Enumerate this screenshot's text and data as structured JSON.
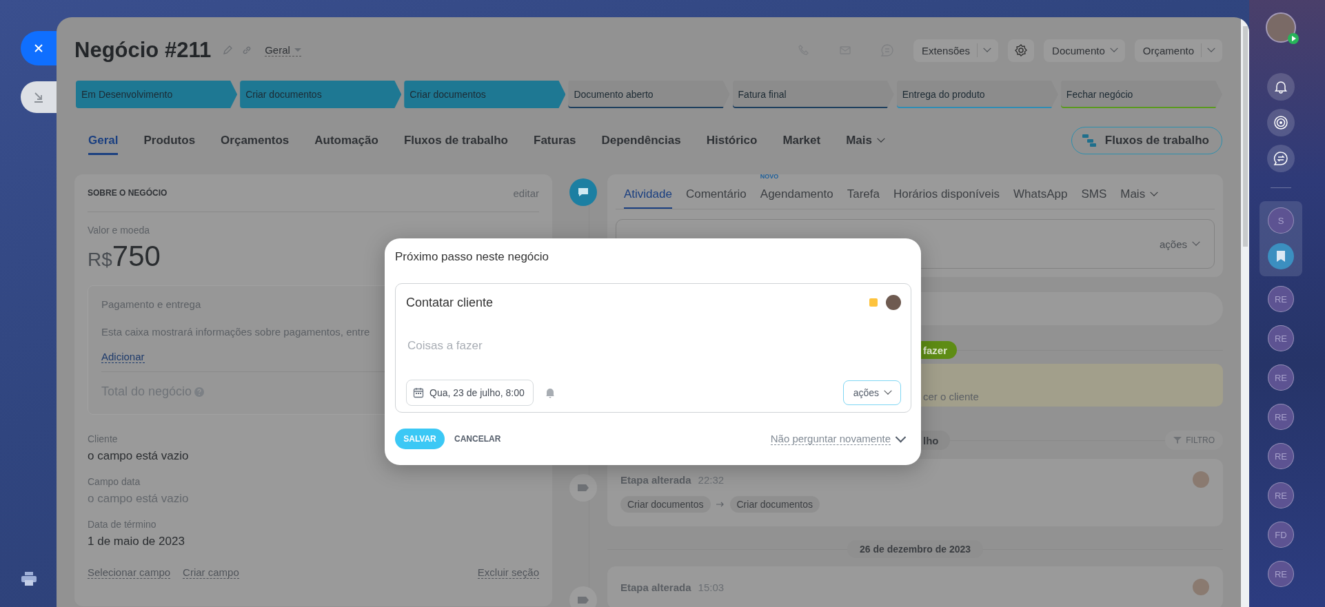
{
  "header": {
    "title": "Negócio #211",
    "category": "Geral",
    "buttons": [
      {
        "kind": "split",
        "label": "Extensões"
      },
      {
        "kind": "icon"
      },
      {
        "kind": "dropdown",
        "label": "Documento"
      },
      {
        "kind": "split",
        "label": "Orçamento"
      }
    ]
  },
  "stages": [
    {
      "label": "Em Desenvolvimento",
      "reached": true,
      "color": "#1e7893"
    },
    {
      "label": "Criar documentos",
      "reached": true,
      "color": "#1e7893"
    },
    {
      "label": "Criar documentos",
      "reached": true,
      "color": "#1e7893"
    },
    {
      "label": "Documento aberto",
      "reached": false,
      "color": "#1d3f5e"
    },
    {
      "label": "Fatura final",
      "reached": false,
      "color": "#1d3f5e"
    },
    {
      "label": "Entrega do produto",
      "reached": false,
      "color": "#2f8db5"
    },
    {
      "label": "Fechar negócio",
      "reached": false,
      "color": "#5a9a1e"
    }
  ],
  "tabs": [
    {
      "label": "Geral",
      "selected": true,
      "kind": "tab"
    },
    {
      "label": "Produtos",
      "selected": false,
      "kind": "tab"
    },
    {
      "label": "Orçamentos",
      "selected": false,
      "kind": "tab"
    },
    {
      "label": "Automação",
      "selected": false,
      "kind": "tab"
    },
    {
      "label": "Fluxos de trabalho",
      "selected": false,
      "kind": "tab"
    },
    {
      "label": "Faturas",
      "selected": false,
      "kind": "tab"
    },
    {
      "label": "Dependências",
      "selected": false,
      "kind": "tab"
    },
    {
      "label": "Histórico",
      "selected": false,
      "kind": "tab"
    },
    {
      "label": "Market",
      "selected": false,
      "kind": "tab"
    },
    {
      "label": "Mais",
      "selected": false,
      "kind": "menu"
    }
  ],
  "workflow_button": "Fluxos de trabalho",
  "about": {
    "title": "SOBRE O NEGÓCIO",
    "edit": "editar",
    "amount_label": "Valor e moeda",
    "currency": "R$",
    "amount": "750",
    "payment": {
      "title": "Pagamento e entrega",
      "description": "Esta caixa mostrará informações sobre pagamentos, entre",
      "link": "Adicionar",
      "total_label": "Total do negócio"
    },
    "fields": [
      {
        "label": "Cliente",
        "value": "o campo está vazio",
        "muted": false
      },
      {
        "label": "Campo data",
        "value": "o campo está vazio",
        "muted": true
      },
      {
        "label": "Data de término",
        "value": "1 de maio de 2023",
        "muted": false
      }
    ],
    "links": [
      "Selecionar campo",
      "Criar campo"
    ],
    "delete_link": "Excluir seção"
  },
  "activity": {
    "tabs": [
      {
        "label": "Atividade",
        "selected": true,
        "kind": "tab"
      },
      {
        "label": "Comentário",
        "selected": false,
        "kind": "tab"
      },
      {
        "label": "Agendamento",
        "selected": false,
        "kind": "tab",
        "badge": "NOVO"
      },
      {
        "label": "Tarefa",
        "selected": false,
        "kind": "tab"
      },
      {
        "label": "Horários disponíveis",
        "selected": false,
        "kind": "tab"
      },
      {
        "label": "WhatsApp",
        "selected": false,
        "kind": "tab"
      },
      {
        "label": "SMS",
        "selected": false,
        "kind": "tab"
      },
      {
        "label": "Mais",
        "selected": false,
        "kind": "menu"
      }
    ],
    "composer_actions": "ações",
    "section_label": "fazer",
    "task_text": "cer o cliente",
    "history_label": "lho",
    "filter_button": "FILTRO",
    "feed": [
      {
        "kind": "entry",
        "title": "Etapa alterada",
        "time": "22:32",
        "from": "Criar documentos",
        "to": "Criar documentos"
      },
      {
        "kind": "date",
        "label": "26 de dezembro de 2023"
      },
      {
        "kind": "entry",
        "title": "Etapa alterada",
        "time": "15:03"
      }
    ]
  },
  "modal": {
    "title": "Próximo passo neste negócio",
    "subject": "Contatar cliente",
    "placeholder": "Coisas a fazer",
    "date": "Qua, 23 de julho, 8:00",
    "actions": "ações",
    "save": "SALVAR",
    "cancel": "CANCELAR",
    "dont_ask": "Não perguntar novamente"
  },
  "sidebar": {
    "pinned": [
      {
        "kind": "initials",
        "text": "S"
      },
      {
        "kind": "bookmark"
      }
    ],
    "chats": [
      "RE",
      "RE",
      "RE",
      "RE",
      "RE",
      "RE",
      "FD",
      "RE"
    ]
  }
}
